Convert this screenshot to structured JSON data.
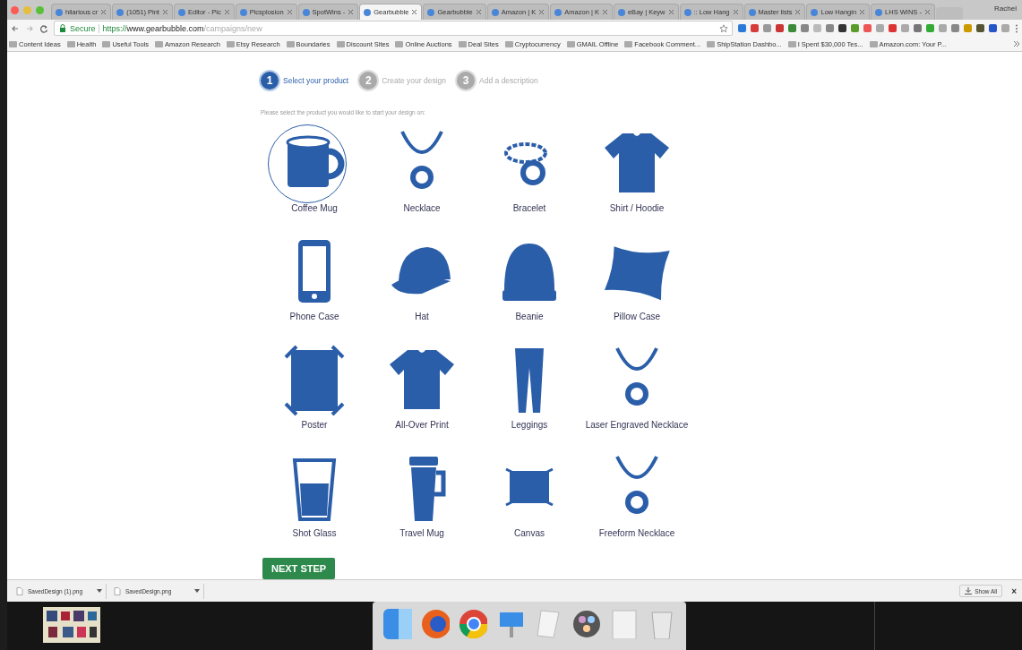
{
  "tabs": [
    {
      "label": "hilarious cr",
      "selected": false
    },
    {
      "label": "(1051) Pint",
      "selected": false
    },
    {
      "label": "Editor - Pic",
      "selected": false
    },
    {
      "label": "Picsplosion",
      "selected": false
    },
    {
      "label": "SpotWins -",
      "selected": false
    },
    {
      "label": "Gearbubble",
      "selected": true
    },
    {
      "label": "Gearbubble",
      "selected": false
    },
    {
      "label": "Amazon | K",
      "selected": false
    },
    {
      "label": "Amazon | K",
      "selected": false
    },
    {
      "label": "eBay | Keyw",
      "selected": false
    },
    {
      "label": ":: Low Hang",
      "selected": false
    },
    {
      "label": "Master lists",
      "selected": false
    },
    {
      "label": "Low Hangin",
      "selected": false
    },
    {
      "label": "LHS WINS -",
      "selected": false
    }
  ],
  "profile": "Rachel",
  "address_bar": {
    "secure_label": "Secure",
    "url_scheme": "https://",
    "url_host": "www.gearbubble.com",
    "url_path": "/campaigns/new"
  },
  "bookmarks": [
    "Content Ideas",
    "Health",
    "Useful Tools",
    "Amazon Research",
    "Etsy Research",
    "Boundaries",
    "Discount Sites",
    "Online Auctions",
    "Deal Sites",
    "Cryptocurrency",
    "GMAIL Offline",
    "Facebook Comment...",
    "ShipStation Dashbo...",
    "I Spent $30,000 Tes...",
    "Amazon.com: Your P..."
  ],
  "steps": [
    {
      "number": "1",
      "label": "Select your product",
      "selected": true
    },
    {
      "number": "2",
      "label": "Create your design",
      "selected": false
    },
    {
      "number": "3",
      "label": "Add a description",
      "selected": false
    }
  ],
  "instruction": "Please select the product you would like to start your design on:",
  "products": [
    {
      "label": "Coffee Mug",
      "kind": "mug",
      "selected": true
    },
    {
      "label": "Necklace",
      "kind": "necklace",
      "selected": false
    },
    {
      "label": "Bracelet",
      "kind": "bracelet",
      "selected": false
    },
    {
      "label": "Shirt / Hoodie",
      "kind": "shirt",
      "selected": false
    },
    {
      "label": "Phone Case",
      "kind": "phone",
      "selected": false
    },
    {
      "label": "Hat",
      "kind": "hat",
      "selected": false
    },
    {
      "label": "Beanie",
      "kind": "beanie",
      "selected": false
    },
    {
      "label": "Pillow Case",
      "kind": "pillow",
      "selected": false
    },
    {
      "label": "Poster",
      "kind": "poster",
      "selected": false
    },
    {
      "label": "All-Over Print",
      "kind": "shirt",
      "selected": false
    },
    {
      "label": "Leggings",
      "kind": "leggings",
      "selected": false
    },
    {
      "label": "Laser Engraved Necklace",
      "kind": "necklace",
      "selected": false
    },
    {
      "label": "Shot Glass",
      "kind": "shotglass",
      "selected": false
    },
    {
      "label": "Travel Mug",
      "kind": "travelmug",
      "selected": false
    },
    {
      "label": "Canvas",
      "kind": "canvas",
      "selected": false
    },
    {
      "label": "Freeform Necklace",
      "kind": "necklace",
      "selected": false
    }
  ],
  "next_button": "NEXT STEP",
  "downloads": [
    "SavedDesign (1).png",
    "SavedDesign.png"
  ],
  "show_all": "Show All",
  "close_downloads": "×"
}
